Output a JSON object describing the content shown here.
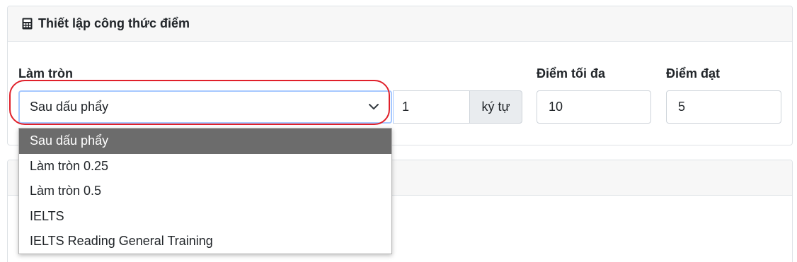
{
  "header": {
    "title": "Thiết lập công thức điểm",
    "icon": "calculator-icon"
  },
  "rounding": {
    "label": "Làm tròn",
    "selected": "Sau dấu phẩy",
    "digits_value": "1",
    "digits_unit": "ký tự",
    "options": [
      "Sau dấu phẩy",
      "Làm tròn 0.25",
      "Làm tròn 0.5",
      "IELTS",
      "IELTS Reading General Training"
    ]
  },
  "max_score": {
    "label": "Điểm tối đa",
    "value": "10"
  },
  "pass_score": {
    "label": "Điểm đạt",
    "value": "5"
  },
  "colors": {
    "highlight": "#e0202a",
    "focus_border": "#a6c8ff",
    "selected_option_bg": "#6c6c6c"
  }
}
